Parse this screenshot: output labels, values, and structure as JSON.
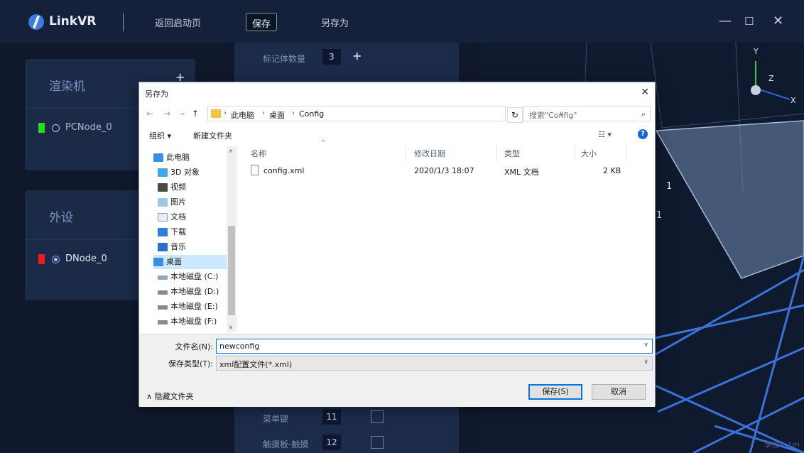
{
  "app": {
    "name": "LinkVR",
    "menu": {
      "back": "返回启动页",
      "save": "保存",
      "save_as": "另存为"
    },
    "window": {
      "minimize": "—",
      "maximize": "☐",
      "close": "✕"
    }
  },
  "render_panel": {
    "title": "渲染机",
    "add": "+",
    "nodes": [
      {
        "label": "PCNode_0",
        "color": "#22dd22"
      }
    ]
  },
  "device_panel": {
    "title": "外设",
    "nodes": [
      {
        "label": "DNode_0",
        "color": "#ee1c1c"
      }
    ]
  },
  "center": {
    "marker_label": "标记体数量",
    "marker_count": "3",
    "add": "+",
    "rows": [
      {
        "label": "菜单键",
        "value": "11"
      },
      {
        "label": "触摸板-触摸",
        "value": "12"
      }
    ]
  },
  "view3d": {
    "axis_y": "Y",
    "axis_z": "Z",
    "axis_x": "X",
    "unit": "单位：1m",
    "tag_1": "1",
    "tag_2": "1"
  },
  "dialog": {
    "title": "另存为",
    "close": "✕",
    "nav": {
      "back": "←",
      "forward": "→",
      "recent": "⌄",
      "up": "↑"
    },
    "breadcrumb": [
      "此电脑",
      "桌面",
      "Config"
    ],
    "refresh": "↻",
    "search_placeholder": "搜索\"Config\"",
    "toolbar": {
      "organize": "组织 ▾",
      "new_folder": "新建文件夹",
      "view": "☷ ▾",
      "help": "?"
    },
    "nav_items": [
      {
        "label": "此电脑",
        "icon": "computer-icon"
      },
      {
        "label": "3D 对象",
        "icon": "3d-objects-icon"
      },
      {
        "label": "视频",
        "icon": "video-icon"
      },
      {
        "label": "图片",
        "icon": "pictures-icon"
      },
      {
        "label": "文档",
        "icon": "documents-icon"
      },
      {
        "label": "下载",
        "icon": "download-icon"
      },
      {
        "label": "音乐",
        "icon": "music-icon"
      },
      {
        "label": "桌面",
        "icon": "desktop-icon"
      },
      {
        "label": "本地磁盘 (C:)",
        "icon": "drive-icon"
      },
      {
        "label": "本地磁盘 (D:)",
        "icon": "drive-icon"
      },
      {
        "label": "本地磁盘 (E:)",
        "icon": "drive-icon"
      },
      {
        "label": "本地磁盘 (F:)",
        "icon": "drive-icon"
      }
    ],
    "columns": {
      "name": "名称",
      "modified": "修改日期",
      "type": "类型",
      "size": "大小"
    },
    "files": [
      {
        "name": "config.xml",
        "modified": "2020/1/3 18:07",
        "type": "XML 文档",
        "size": "2 KB"
      }
    ],
    "filename_label": "文件名(N):",
    "filename_value": "newconfig",
    "filetype_label": "保存类型(T):",
    "filetype_value": "xml配置文件(*.xml)",
    "hide_folders": "∧ 隐藏文件夹",
    "save_button": "保存(S)",
    "cancel_button": "取消"
  }
}
